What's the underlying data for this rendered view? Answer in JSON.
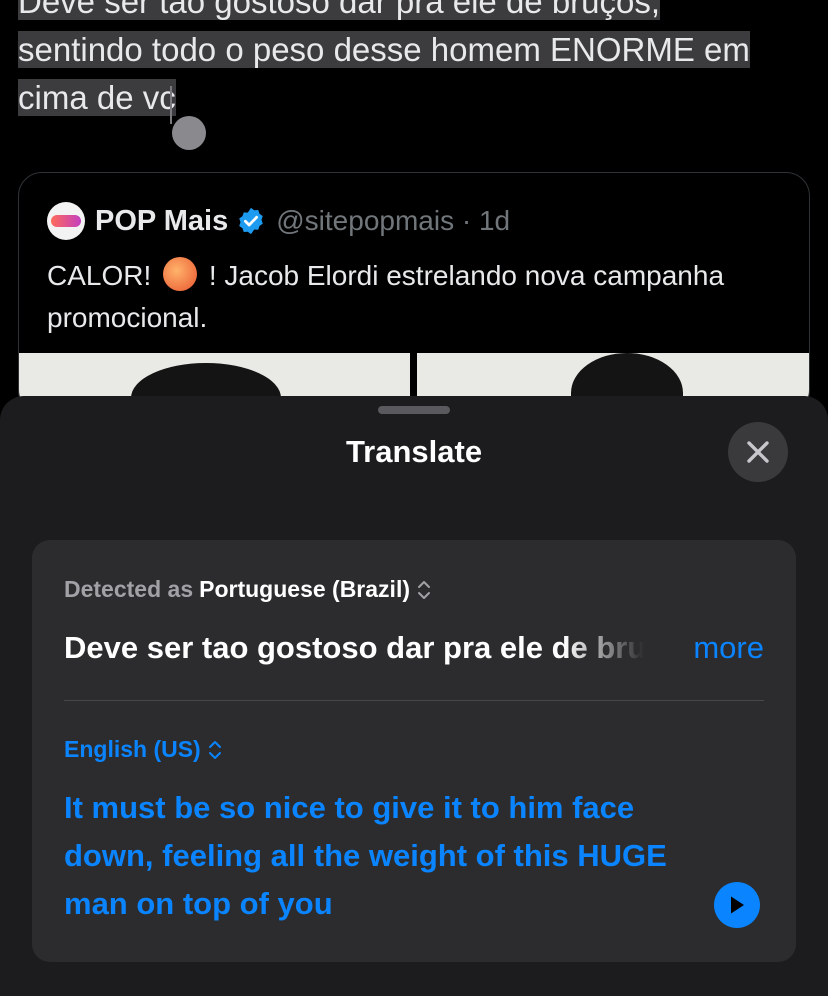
{
  "background_post": {
    "selected_lines": [
      "Deve ser tao gostoso dar pra ele de bruços,",
      "sentindo todo o peso desse homem ENORME em",
      "cima de vc"
    ]
  },
  "quoted_post": {
    "name": "POP Mais",
    "handle_time": "@sitepopmais · 1d",
    "text_before_emoji": "CALOR!",
    "text_after_emoji": "! Jacob Elordi estrelando nova campanha promocional."
  },
  "translate_sheet": {
    "title": "Translate",
    "detected_label": "Detected as",
    "detected_language": "Portuguese (Brazil)",
    "source_text": "Deve ser tao gostoso dar pra ele de bruços, sentindo todo o peso desse homem ENORME em cima de vc",
    "more_label": "more",
    "target_language": "English (US)",
    "translation": "It must be so nice to give it to him face down, feeling all the weight of this HUGE man on top of you"
  },
  "colors": {
    "accent": "#0a84ff",
    "sheet_bg": "#1c1c1e",
    "card_bg": "#2c2c2e",
    "verified": "#1d9bf0"
  },
  "icons": {
    "close": "close-icon",
    "play": "play-icon",
    "chevron": "chevron-up-down-icon",
    "verified": "verified-badge-icon"
  }
}
